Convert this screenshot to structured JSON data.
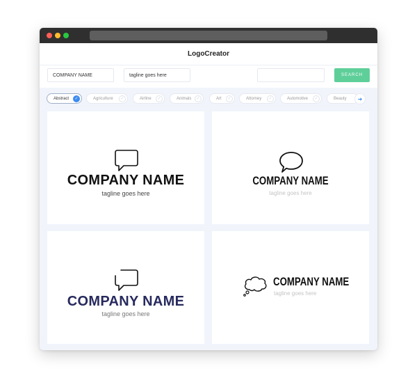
{
  "browser": {
    "traffic_lights": [
      "close",
      "minimize",
      "maximize"
    ],
    "colors": {
      "close": "#ff5f57",
      "minimize": "#febc2e",
      "maximize": "#28c840"
    }
  },
  "app": {
    "title": "LogoCreator"
  },
  "search": {
    "company_value": "COMPANY NAME",
    "tagline_value": "tagline goes here",
    "keyword_value": "",
    "button_label": "SEARCH",
    "button_color": "#5fcf9a"
  },
  "categories": {
    "items": [
      {
        "label": "Abstract",
        "selected": true
      },
      {
        "label": "Agriculture",
        "selected": false
      },
      {
        "label": "Airline",
        "selected": false
      },
      {
        "label": "Animals",
        "selected": false
      },
      {
        "label": "Art",
        "selected": false
      },
      {
        "label": "Attorney",
        "selected": false
      },
      {
        "label": "Automotive",
        "selected": false
      },
      {
        "label": "Beauty",
        "selected": false
      }
    ],
    "next_icon": "arrow-right-icon",
    "accent_color": "#3d8cf0"
  },
  "logos": [
    {
      "company": "COMPANY NAME",
      "tagline": "tagline goes here",
      "icon": "speech-bubble-icon",
      "name_color": "#111111"
    },
    {
      "company": "COMPANY NAME",
      "tagline": "tagline goes here",
      "icon": "round-speech-bubble-icon",
      "name_color": "#111111"
    },
    {
      "company": "COMPANY NAME",
      "tagline": "tagline goes here",
      "icon": "broken-speech-bubble-icon",
      "name_color": "#272a5e"
    },
    {
      "company": "COMPANY NAME",
      "tagline": "tagline goes here",
      "icon": "thought-bubble-icon",
      "name_color": "#111111"
    }
  ]
}
